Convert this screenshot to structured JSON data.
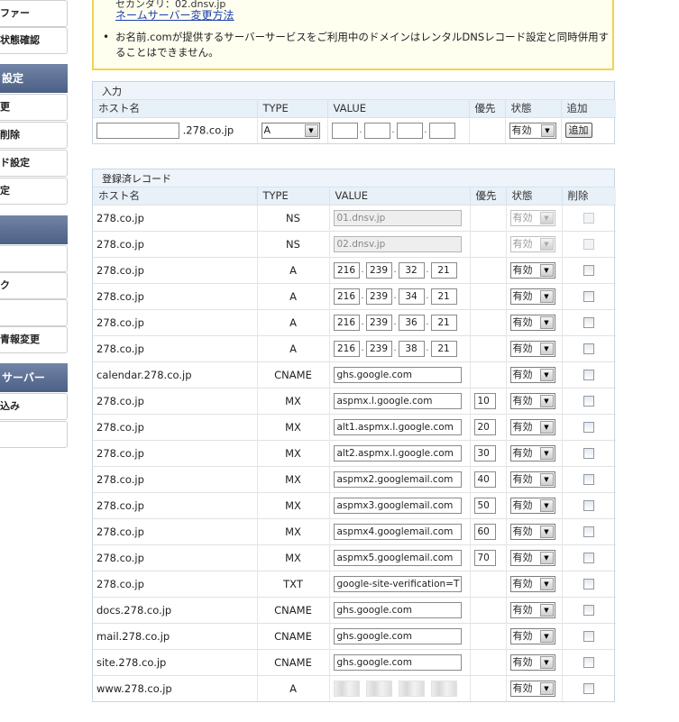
{
  "sidebar": {
    "items": [
      {
        "kind": "item",
        "label": "ファー"
      },
      {
        "kind": "item",
        "label": "状態確認"
      },
      {
        "kind": "head",
        "label": "設定"
      },
      {
        "kind": "item",
        "label": "更"
      },
      {
        "kind": "item",
        "label": "削除"
      },
      {
        "kind": "item",
        "label": "ド設定"
      },
      {
        "kind": "item",
        "label": "定"
      },
      {
        "kind": "head",
        "label": ""
      },
      {
        "kind": "item",
        "label": ""
      },
      {
        "kind": "item",
        "label": "ク"
      },
      {
        "kind": "item",
        "label": ""
      },
      {
        "kind": "item",
        "label": "青報変更"
      },
      {
        "kind": "head",
        "label": "サーバー"
      },
      {
        "kind": "item",
        "label": "込み"
      },
      {
        "kind": "item",
        "label": ""
      }
    ]
  },
  "notice": {
    "line1": "セカンダリ：02.dnsv.jp",
    "link": "ネームサーバー変更方法",
    "bullet": "•",
    "text": "お名前.comが提供するサーバーサービスをご利用中のドメインはレンタルDNSレコード設定と同時併用することはできません。"
  },
  "input_panel": {
    "title": "入力",
    "headers": [
      "ホスト名",
      "TYPE",
      "VALUE",
      "優先",
      "状態",
      "追加"
    ],
    "host_suffix": ".278.co.jp",
    "type_value": "A",
    "status_value": "有効",
    "add_label": "追加"
  },
  "records_panel": {
    "title": "登録済レコード",
    "headers": [
      "ホスト名",
      "TYPE",
      "VALUE",
      "優先",
      "状態",
      "削除"
    ],
    "rows": [
      {
        "host": "278.co.jp",
        "type": "NS",
        "value": "01.dnsv.jp",
        "priority": "",
        "status": "有効",
        "disabled": true,
        "kind": "text"
      },
      {
        "host": "278.co.jp",
        "type": "NS",
        "value": "02.dnsv.jp",
        "priority": "",
        "status": "有効",
        "disabled": true,
        "kind": "text"
      },
      {
        "host": "278.co.jp",
        "type": "A",
        "octets": [
          "216",
          "239",
          "32",
          "21"
        ],
        "priority": "",
        "status": "有効",
        "disabled": false,
        "kind": "ip"
      },
      {
        "host": "278.co.jp",
        "type": "A",
        "octets": [
          "216",
          "239",
          "34",
          "21"
        ],
        "priority": "",
        "status": "有効",
        "disabled": false,
        "kind": "ip"
      },
      {
        "host": "278.co.jp",
        "type": "A",
        "octets": [
          "216",
          "239",
          "36",
          "21"
        ],
        "priority": "",
        "status": "有効",
        "disabled": false,
        "kind": "ip"
      },
      {
        "host": "278.co.jp",
        "type": "A",
        "octets": [
          "216",
          "239",
          "38",
          "21"
        ],
        "priority": "",
        "status": "有効",
        "disabled": false,
        "kind": "ip"
      },
      {
        "host": "calendar.278.co.jp",
        "type": "CNAME",
        "value": "ghs.google.com",
        "priority": "",
        "status": "有効",
        "disabled": false,
        "kind": "text"
      },
      {
        "host": "278.co.jp",
        "type": "MX",
        "value": "aspmx.l.google.com",
        "priority": "10",
        "status": "有効",
        "disabled": false,
        "kind": "text"
      },
      {
        "host": "278.co.jp",
        "type": "MX",
        "value": "alt1.aspmx.l.google.com",
        "priority": "20",
        "status": "有効",
        "disabled": false,
        "kind": "text"
      },
      {
        "host": "278.co.jp",
        "type": "MX",
        "value": "alt2.aspmx.l.google.com",
        "priority": "30",
        "status": "有効",
        "disabled": false,
        "kind": "text"
      },
      {
        "host": "278.co.jp",
        "type": "MX",
        "value": "aspmx2.googlemail.com",
        "priority": "40",
        "status": "有効",
        "disabled": false,
        "kind": "text"
      },
      {
        "host": "278.co.jp",
        "type": "MX",
        "value": "aspmx3.googlemail.com",
        "priority": "50",
        "status": "有効",
        "disabled": false,
        "kind": "text"
      },
      {
        "host": "278.co.jp",
        "type": "MX",
        "value": "aspmx4.googlemail.com",
        "priority": "60",
        "status": "有効",
        "disabled": false,
        "kind": "text"
      },
      {
        "host": "278.co.jp",
        "type": "MX",
        "value": "aspmx5.googlemail.com",
        "priority": "70",
        "status": "有効",
        "disabled": false,
        "kind": "text"
      },
      {
        "host": "278.co.jp",
        "type": "TXT",
        "value": "google-site-verification=T",
        "priority": "",
        "status": "有効",
        "disabled": false,
        "kind": "text"
      },
      {
        "host": "docs.278.co.jp",
        "type": "CNAME",
        "value": "ghs.google.com",
        "priority": "",
        "status": "有効",
        "disabled": false,
        "kind": "text"
      },
      {
        "host": "mail.278.co.jp",
        "type": "CNAME",
        "value": "ghs.google.com",
        "priority": "",
        "status": "有効",
        "disabled": false,
        "kind": "text"
      },
      {
        "host": "site.278.co.jp",
        "type": "CNAME",
        "value": "ghs.google.com",
        "priority": "",
        "status": "有効",
        "disabled": false,
        "kind": "text"
      },
      {
        "host": "www.278.co.jp",
        "type": "A",
        "octets": [
          "11",
          "",
          "112",
          ""
        ],
        "priority": "",
        "status": "有効",
        "disabled": false,
        "kind": "ip",
        "blurred": true
      }
    ]
  },
  "colors": {
    "sidebar_head": "#5a6d92",
    "notice_border": "#f1d44a",
    "panel_header": "#e8f0f8",
    "link": "#1a3fb0"
  }
}
